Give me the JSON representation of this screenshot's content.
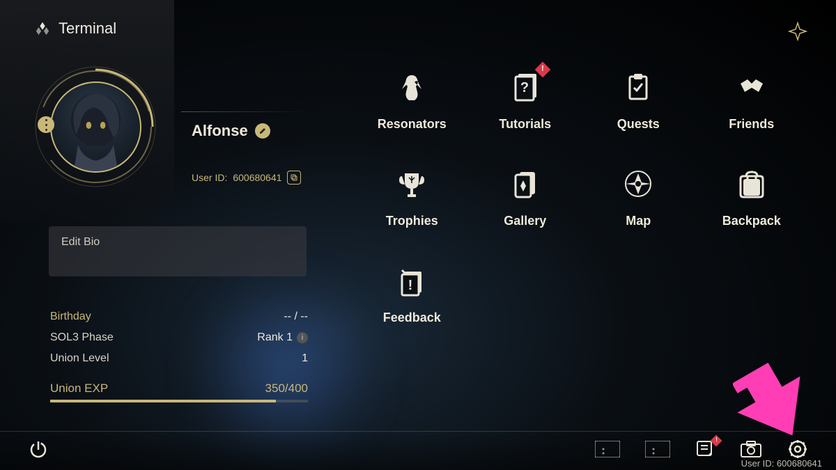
{
  "header": {
    "title": "Terminal"
  },
  "profile": {
    "name": "Alfonse",
    "uid_label": "User ID:",
    "uid": "600680641",
    "bio_placeholder": "Edit Bio"
  },
  "stats": {
    "birthday_label": "Birthday",
    "birthday_value": "-- / --",
    "phase_label": "SOL3 Phase",
    "phase_value": "Rank 1",
    "level_label": "Union Level",
    "level_value": "1",
    "exp_label": "Union EXP",
    "exp_value": "350/400",
    "exp_fill_pct": 87.5
  },
  "menu": [
    {
      "key": "resonators",
      "label": "Resonators",
      "notif": false
    },
    {
      "key": "tutorials",
      "label": "Tutorials",
      "notif": true
    },
    {
      "key": "quests",
      "label": "Quests",
      "notif": false
    },
    {
      "key": "friends",
      "label": "Friends",
      "notif": false
    },
    {
      "key": "trophies",
      "label": "Trophies",
      "notif": false
    },
    {
      "key": "gallery",
      "label": "Gallery",
      "notif": false
    },
    {
      "key": "map",
      "label": "Map",
      "notif": false
    },
    {
      "key": "backpack",
      "label": "Backpack",
      "notif": false
    },
    {
      "key": "feedback",
      "label": "Feedback",
      "notif": false
    }
  ],
  "footer": {
    "uid_label": "User ID:",
    "uid": "600680641"
  },
  "colors": {
    "accent": "#c8b878",
    "text": "#efe9da",
    "danger": "#d93a4a",
    "arrow": "#ff3eb5"
  }
}
